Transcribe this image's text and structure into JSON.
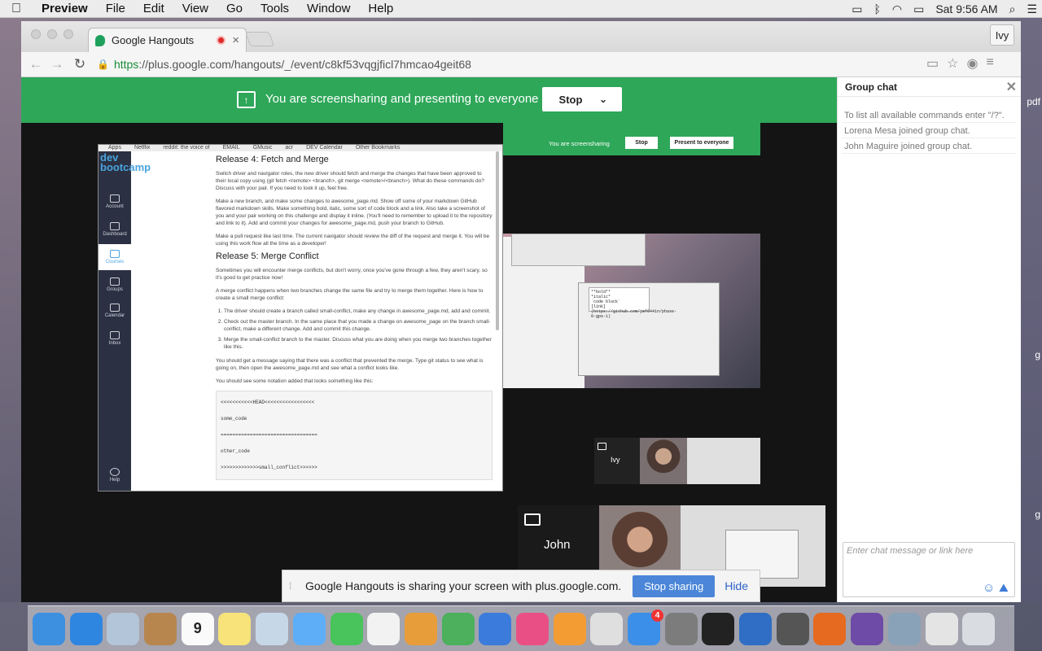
{
  "menubar": {
    "app": "Preview",
    "items": [
      "File",
      "Edit",
      "View",
      "Go",
      "Tools",
      "Window",
      "Help"
    ],
    "clock": "Sat 9:56 AM"
  },
  "browser": {
    "tab_title": "Google Hangouts",
    "profile": "Ivy",
    "url_scheme": "https",
    "url_rest": "://plus.google.com/hangouts/_/event/c8kf53vqgjficl7hmcao4geit68"
  },
  "banner": {
    "text": "You are screensharing and presenting to everyone",
    "stop_label": "Stop"
  },
  "doc": {
    "bookmarks": [
      "Apps",
      "Netflix",
      "reddit: the voice of",
      "EMAIL",
      "GMusic",
      "acr",
      "DEV Calendar",
      "Other Bookmarks"
    ],
    "brand": "dev bootcamp",
    "nav": [
      "Account",
      "Dashboard",
      "Courses",
      "Groups",
      "Calendar",
      "Inbox",
      "Help"
    ],
    "h_release4": "Release 4: Fetch and Merge",
    "p1": "Switch driver and navigator roles, the new driver should fetch and merge the changes that have been approved to their local copy using (git fetch <remote> <branch>, git merge <remote>/<branch>). What do these commands do? Discuss with your pair. If you need to look it up, feel free.",
    "p2": "Make a new branch, and make some changes to awesome_page.md. Show off some of your markdown GitHub flavored markdown skills. Make something bold, italic, some sort of code block and a link. Also take a screenshot of you and your pair working on this challenge and display it inline. (You'll need to remember to upload it to the repository and link to it). Add and commit your changes for awesome_page.md, push your branch to GitHub.",
    "p3": "Make a pull request like last time. The current navigator should review the diff of the request and merge it. You will be using this work flow all the time as a developer!",
    "h_release5": "Release 5: Merge Conflict",
    "p4": "Sometimes you will encounter merge conflicts, but don't worry, once you've gone through a few, they aren't scary, so it's good to get practice now!",
    "p5": "A merge conflict happens when two branches change the same file and try to merge them together. Here is how to create a small merge conflict:",
    "li": [
      "The driver should create a branch called small-conflict, make any change in awesome_page.md, add and commit.",
      "Check out the master branch. In the same place that you made a change on awesome_page on the branch small-conflict, make a different change. Add and commit this change.",
      "Merge the small-conflict branch to the master. Discuss what you are doing when you merge two branches together like this."
    ],
    "p6": "You should get a message saying that there was a conflict that prevented the merge. Type git status to see what is going on, then open the awesome_page.md and see what a conflict looks like.",
    "p7": "You should see some notation added that looks something like this:",
    "code": [
      "<<<<<<<<<<<HEAD<<<<<<<<<<<<<<<<<",
      "some_code",
      "=================================",
      "other_code",
      ">>>>>>>>>>>>>small_conflict>>>>>>"
    ]
  },
  "mini": {
    "text": "You are screensharing",
    "stop": "Stop",
    "present": "Present to everyone",
    "term": [
      "**bold**",
      "*italic*",
      "`code block`",
      "[link](https://github.com/jmf6441n/phase-0-gps-1)"
    ]
  },
  "participants": {
    "ivy": "Ivy",
    "john": "John"
  },
  "sharebar": {
    "text": "Google Hangouts is sharing your screen with plus.google.com.",
    "stop": "Stop sharing",
    "hide": "Hide"
  },
  "chat": {
    "title": "Group chat",
    "messages": [
      "To list all available commands enter \"/?\".",
      "Lorena Mesa joined group chat.",
      "John Maguire joined group chat."
    ],
    "placeholder": "Enter chat message or link here"
  },
  "dock": {
    "apps": [
      {
        "name": "finder",
        "color": "#3d8fe0"
      },
      {
        "name": "safari",
        "color": "#2f86e0"
      },
      {
        "name": "mail",
        "color": "#b3c5d8"
      },
      {
        "name": "contacts",
        "color": "#b7864f"
      },
      {
        "name": "calendar",
        "color": "#fafafa",
        "label": "9"
      },
      {
        "name": "notes",
        "color": "#f7e37a"
      },
      {
        "name": "preview",
        "color": "#c6d8e8"
      },
      {
        "name": "messages",
        "color": "#5eaef7"
      },
      {
        "name": "facetime",
        "color": "#49c35b"
      },
      {
        "name": "photos",
        "color": "#f2f2f2"
      },
      {
        "name": "pages",
        "color": "#e89d3b"
      },
      {
        "name": "numbers",
        "color": "#4cb05c"
      },
      {
        "name": "keynote",
        "color": "#3b7bdb"
      },
      {
        "name": "itunes",
        "color": "#e94f84"
      },
      {
        "name": "ibooks",
        "color": "#f39c34"
      },
      {
        "name": "chrome",
        "color": "#dfdfdf"
      },
      {
        "name": "app-store",
        "color": "#3b8fe8",
        "badge": "4"
      },
      {
        "name": "system-preferences",
        "color": "#7c7c7c"
      },
      {
        "name": "terminal",
        "color": "#222222"
      },
      {
        "name": "wunderlist",
        "color": "#2f6ec4"
      },
      {
        "name": "sublime-text",
        "color": "#555555"
      },
      {
        "name": "firefox",
        "color": "#e66a1f"
      },
      {
        "name": "github",
        "color": "#6e4ba7"
      },
      {
        "name": "image-capture",
        "color": "#8aa2b8"
      },
      {
        "name": "downloads",
        "color": "#e4e4e4"
      },
      {
        "name": "trash",
        "color": "#d9dde2"
      }
    ]
  }
}
